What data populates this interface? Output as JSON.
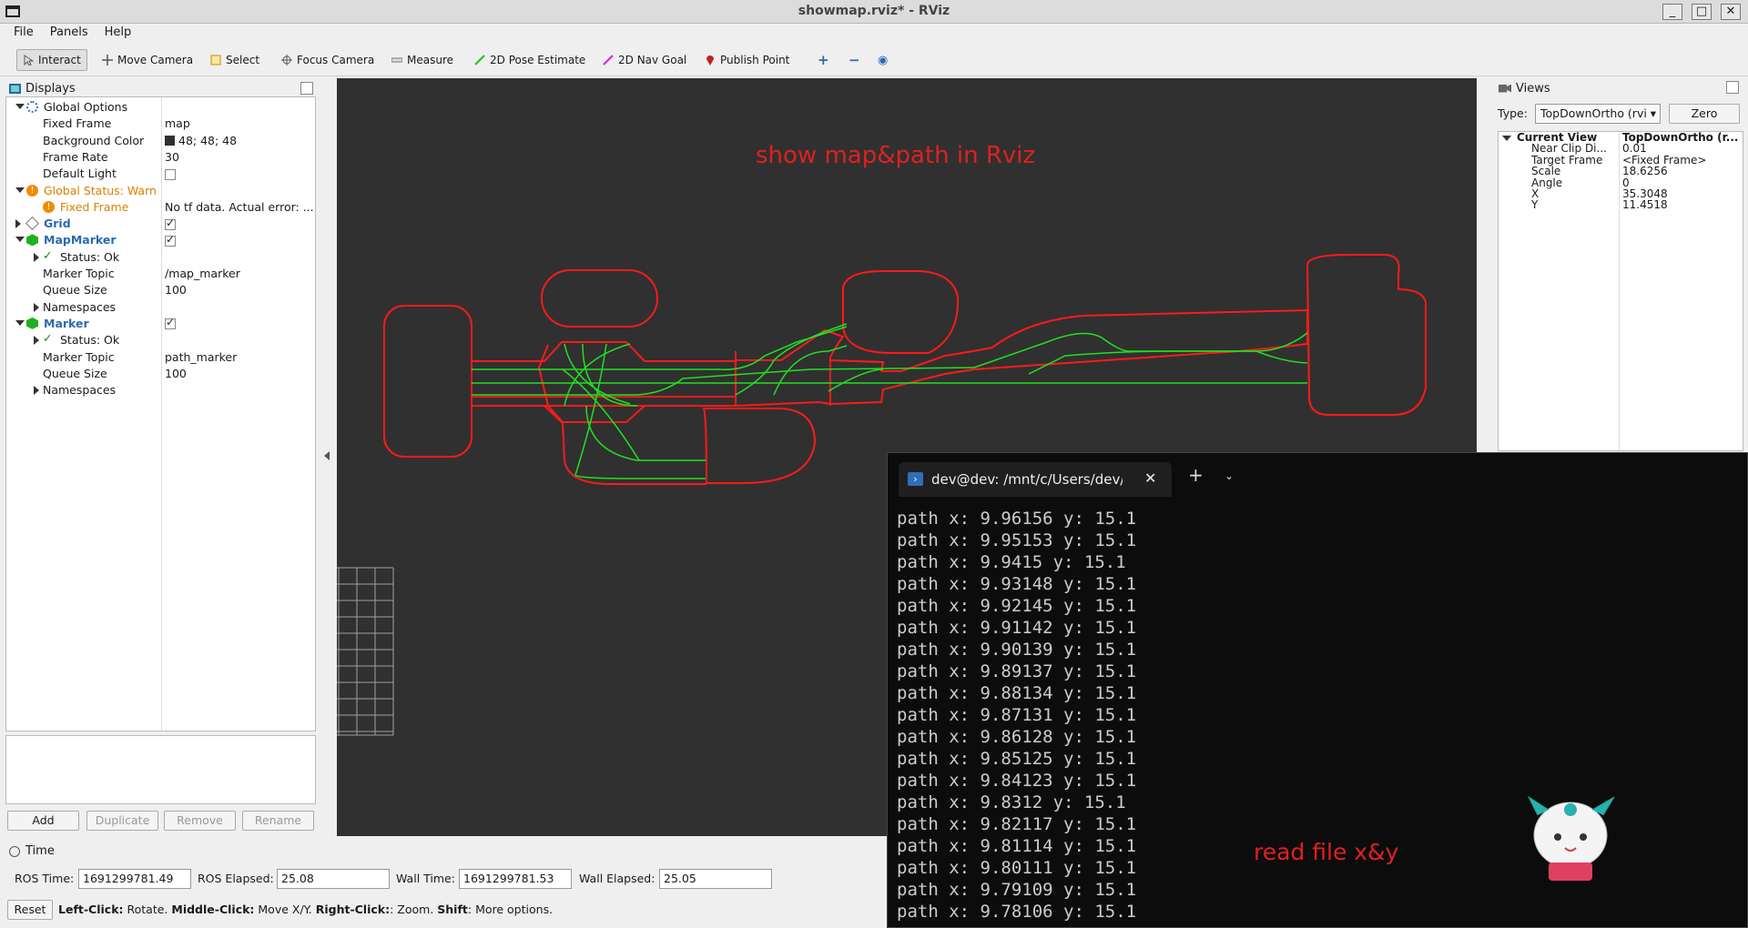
{
  "window": {
    "title": "showmap.rviz* - RViz",
    "controls": [
      "_",
      "□",
      "✕"
    ]
  },
  "menu": [
    "File",
    "Panels",
    "Help"
  ],
  "toolbar": [
    {
      "label": "Interact",
      "icon": "interact-icon",
      "color": "#555555"
    },
    {
      "label": "Move Camera",
      "icon": "move-camera-icon",
      "color": "#555555"
    },
    {
      "label": "Select",
      "icon": "select-icon",
      "color": "#d8b000"
    },
    {
      "label": "Focus Camera",
      "icon": "focus-camera-icon",
      "color": "#555555"
    },
    {
      "label": "Measure",
      "icon": "measure-icon",
      "color": "#777777"
    },
    {
      "label": "2D Pose Estimate",
      "icon": "pose-estimate-icon",
      "color": "#20c020"
    },
    {
      "label": "2D Nav Goal",
      "icon": "nav-goal-icon",
      "color": "#e020e0"
    },
    {
      "label": "Publish Point",
      "icon": "publish-point-icon",
      "color": "#c02020"
    }
  ],
  "displays": {
    "title": "Displays",
    "rows": [
      {
        "key": "Global Options",
        "value": "",
        "indent": 0,
        "expander": "down",
        "style": "",
        "icon": "gear"
      },
      {
        "key": "Fixed Frame",
        "value": "map",
        "indent": 1
      },
      {
        "key": "Background Color",
        "value": "48; 48; 48",
        "indent": 1,
        "swatch": "#303030"
      },
      {
        "key": "Frame Rate",
        "value": "30",
        "indent": 1
      },
      {
        "key": "Default Light",
        "value": "",
        "indent": 1,
        "check": false
      },
      {
        "key": "Global Status: Warn",
        "value": "",
        "indent": 0,
        "expander": "down",
        "style": "warn",
        "icon": "warn"
      },
      {
        "key": "Fixed Frame",
        "value": "No tf data.  Actual error: ...",
        "indent": 1,
        "style": "warn",
        "icon": "warn"
      },
      {
        "key": "Grid",
        "value": "",
        "indent": 0,
        "expander": "right",
        "style": "blue",
        "icon": "grid",
        "check": true
      },
      {
        "key": "MapMarker",
        "value": "",
        "indent": 0,
        "expander": "down",
        "style": "blue",
        "icon": "cube",
        "check": true
      },
      {
        "key": "Status: Ok",
        "value": "",
        "indent": 1,
        "expander": "right",
        "icon": "ok"
      },
      {
        "key": "Marker Topic",
        "value": "/map_marker",
        "indent": 1
      },
      {
        "key": "Queue Size",
        "value": "100",
        "indent": 1
      },
      {
        "key": "Namespaces",
        "value": "",
        "indent": 1,
        "expander": "right"
      },
      {
        "key": "Marker",
        "value": "",
        "indent": 0,
        "expander": "down",
        "style": "blue",
        "icon": "cube",
        "check": true
      },
      {
        "key": "Status: Ok",
        "value": "",
        "indent": 1,
        "expander": "right",
        "icon": "ok"
      },
      {
        "key": "Marker Topic",
        "value": "path_marker",
        "indent": 1
      },
      {
        "key": "Queue Size",
        "value": "100",
        "indent": 1
      },
      {
        "key": "Namespaces",
        "value": "",
        "indent": 1,
        "expander": "right"
      }
    ],
    "buttons": {
      "add": "Add",
      "duplicate": "Duplicate",
      "remove": "Remove",
      "rename": "Rename"
    }
  },
  "viewport": {
    "annotation": "show map&path in Rviz",
    "background": "#303030"
  },
  "views": {
    "title": "Views",
    "type_label": "Type:",
    "type_value": "TopDownOrtho (rvi",
    "zero": "Zero",
    "rows": [
      {
        "key": "Current View",
        "value": "TopDownOrtho (r...",
        "bold": true
      },
      {
        "key": "Near Clip Di...",
        "value": "0.01"
      },
      {
        "key": "Target Frame",
        "value": "<Fixed Frame>"
      },
      {
        "key": "Scale",
        "value": "18.6256"
      },
      {
        "key": "Angle",
        "value": "0"
      },
      {
        "key": "X",
        "value": "35.3048"
      },
      {
        "key": "Y",
        "value": "11.4518"
      }
    ]
  },
  "time": {
    "title": "Time",
    "ros_time_label": "ROS Time:",
    "ros_time": "1691299781.49",
    "ros_elapsed_label": "ROS Elapsed:",
    "ros_elapsed": "25.08",
    "wall_time_label": "Wall Time:",
    "wall_time": "1691299781.53",
    "wall_elapsed_label": "Wall Elapsed:",
    "wall_elapsed": "25.05",
    "reset": "Reset",
    "hint": [
      {
        "b": "Left-Click:",
        "t": " Rotate. "
      },
      {
        "b": "Middle-Click:",
        "t": " Move X/Y. "
      },
      {
        "b": "Right-Click:",
        "t": ": Zoom. "
      },
      {
        "b": "Shift",
        "t": ": More options."
      }
    ]
  },
  "terminal": {
    "tab_title": "dev@dev: /mnt/c/Users/dev/l",
    "lines": [
      "path x: 9.96156 y: 15.1",
      "path x: 9.95153 y: 15.1",
      "path x: 9.9415 y: 15.1",
      "path x: 9.93148 y: 15.1",
      "path x: 9.92145 y: 15.1",
      "path x: 9.91142 y: 15.1",
      "path x: 9.90139 y: 15.1",
      "path x: 9.89137 y: 15.1",
      "path x: 9.88134 y: 15.1",
      "path x: 9.87131 y: 15.1",
      "path x: 9.86128 y: 15.1",
      "path x: 9.85125 y: 15.1",
      "path x: 9.84123 y: 15.1",
      "path x: 9.8312 y: 15.1",
      "path x: 9.82117 y: 15.1",
      "path x: 9.81114 y: 15.1",
      "path x: 9.80111 y: 15.1",
      "path x: 9.79109 y: 15.1",
      "path x: 9.78106 y: 15.1"
    ],
    "annotation": "read file x&y"
  }
}
